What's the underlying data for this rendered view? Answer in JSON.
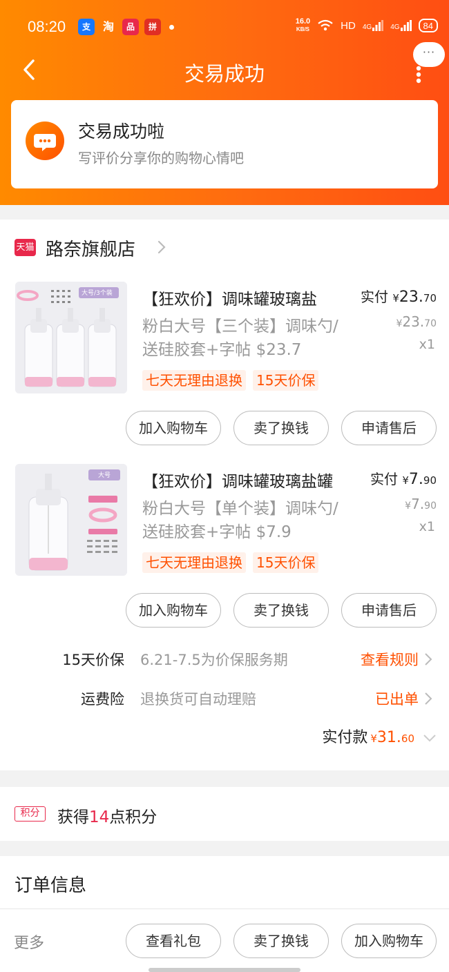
{
  "status_bar": {
    "time": "08:20",
    "app_icons": [
      {
        "name": "alipay-app-icon",
        "text": "支",
        "color": "#1677ff"
      },
      {
        "name": "taobao-app-icon",
        "text": "淘",
        "color": "#ff5000"
      },
      {
        "name": "app-icon-3",
        "text": "品",
        "color": "#e8284b"
      },
      {
        "name": "app-icon-4",
        "text": "拼",
        "color": "#e02e24"
      }
    ],
    "net_speed": "16.0",
    "net_unit": "KB/S",
    "network": "HD",
    "signal1": "4G",
    "signal2": "4G",
    "battery": "84"
  },
  "nav": {
    "title": "交易成功",
    "more_bubble": "···"
  },
  "success": {
    "title": "交易成功啦",
    "subtitle": "写评价分享你的购物心情吧"
  },
  "store": {
    "badge": "天猫",
    "name": "路奈旗舰店"
  },
  "products": [
    {
      "title": "【狂欢价】调味罐玻璃盐",
      "desc": "粉白大号【三个装】调味勺/送硅胶套+字帖 $23.7",
      "pay_label": "实付",
      "currency": "¥",
      "pay_int": "23.",
      "pay_dec": "70",
      "orig_int": "23.",
      "orig_dec": "70",
      "qty": "x1",
      "tags": [
        "七天无理由退换",
        "15天价保"
      ],
      "thumb_label": "大号/3个装",
      "buttons": [
        "加入购物车",
        "卖了换钱",
        "申请售后"
      ]
    },
    {
      "title": "【狂欢价】调味罐玻璃盐罐",
      "desc": "粉白大号【单个装】调味勺/送硅胶套+字帖 $7.9",
      "pay_label": "实付",
      "currency": "¥",
      "pay_int": "7.",
      "pay_dec": "90",
      "orig_int": "7.",
      "orig_dec": "90",
      "qty": "x1",
      "tags": [
        "七天无理由退换",
        "15天价保"
      ],
      "thumb_label": "大号",
      "buttons": [
        "加入购物车",
        "卖了换钱",
        "申请售后"
      ]
    }
  ],
  "services": [
    {
      "label": "15天价保",
      "value": "6.21-7.5为价保服务期",
      "action": "查看规则"
    },
    {
      "label": "运费险",
      "value": "退换货可自动理赔",
      "action": "已出单"
    }
  ],
  "total": {
    "label": "实付款",
    "currency": "¥",
    "int": "31.",
    "dec": "60"
  },
  "points": {
    "badge": "积分",
    "prefix": "获得",
    "num": "14",
    "suffix": "点积分"
  },
  "order": {
    "title": "订单信息",
    "more": "更多",
    "buttons": [
      "查看礼包",
      "卖了换钱",
      "加入购物车"
    ]
  },
  "colors": {
    "accent": "#ff5000",
    "header_start": "#ff8a00",
    "header_end": "#ff4e12",
    "tmall_red": "#e8284b"
  }
}
